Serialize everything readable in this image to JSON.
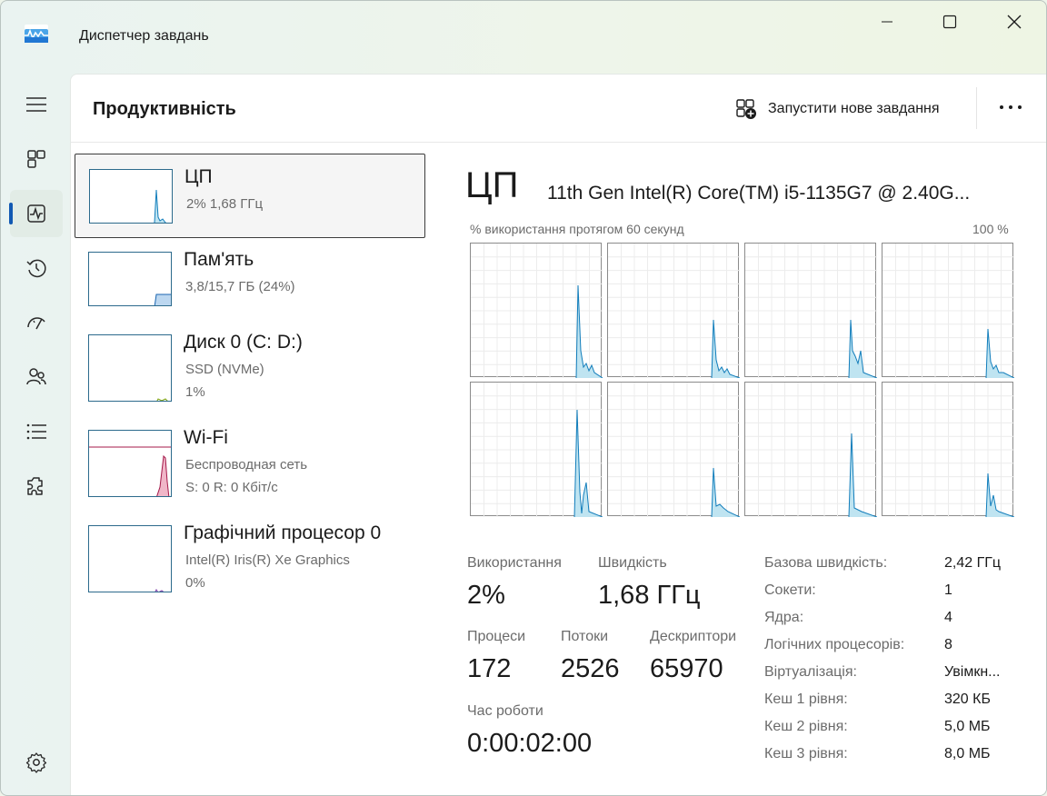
{
  "window": {
    "title": "Диспетчер завдань"
  },
  "header": {
    "page_title": "Продуктивність",
    "run_task_label": "Запустити нове завдання"
  },
  "resources": [
    {
      "name": "ЦП",
      "line1": "2%  1,68 ГГц",
      "line2": ""
    },
    {
      "name": "Пам'ять",
      "line1": "3,8/15,7 ГБ (24%)",
      "line2": ""
    },
    {
      "name": "Диск 0 (C: D:)",
      "line1": "SSD (NVMe)",
      "line2": "1%"
    },
    {
      "name": "Wi-Fi",
      "line1": "Беспроводная сеть",
      "line2": "S: 0  R: 0 Кбіт/с"
    },
    {
      "name": "Графічний процесор 0",
      "line1": "Intel(R) Iris(R) Xe Graphics",
      "line2": "0%"
    }
  ],
  "detail": {
    "title": "ЦП",
    "model": "11th Gen Intel(R) Core(TM) i5-1135G7 @ 2.40G...",
    "graph_caption": "% використання протягом 60 секунд",
    "graph_max": "100 %",
    "stats": {
      "usage_label": "Використання",
      "usage_value": "2%",
      "speed_label": "Швидкість",
      "speed_value": "1,68 ГГц",
      "processes_label": "Процеси",
      "processes_value": "172",
      "threads_label": "Потоки",
      "threads_value": "2526",
      "handles_label": "Дескриптори",
      "handles_value": "65970",
      "uptime_label": "Час роботи",
      "uptime_value": "0:00:02:00"
    },
    "specs": [
      {
        "label": "Базова швидкість:",
        "value": "2,42 ГГц"
      },
      {
        "label": "Сокети:",
        "value": "1"
      },
      {
        "label": "Ядра:",
        "value": "4"
      },
      {
        "label": "Логічних процесорів:",
        "value": "8"
      },
      {
        "label": "Віртуалізація:",
        "value": "Увімкн..."
      },
      {
        "label": "Кеш 1 рівня:",
        "value": "320 КБ"
      },
      {
        "label": "Кеш 2 рівня:",
        "value": "5,0 МБ"
      },
      {
        "label": "Кеш 3 рівня:",
        "value": "8,0 МБ"
      }
    ]
  },
  "colors": {
    "accent": "#1259b3",
    "cpu_line": "#117dbb",
    "cpu_fill": "#bfe4f1",
    "wifi_line": "#a5194a",
    "wifi_fill": "#f0b6c8",
    "memory_fill": "#bcd7f0",
    "disk_line": "#7aa00c",
    "gpu_line": "#7c3aa8"
  },
  "icons": [
    "task-manager-logo-icon",
    "hamburger-icon",
    "processes-icon",
    "performance-icon",
    "app-history-icon",
    "startup-icon",
    "users-icon",
    "details-icon",
    "services-icon",
    "settings-icon",
    "new-task-icon",
    "more-icon"
  ]
}
